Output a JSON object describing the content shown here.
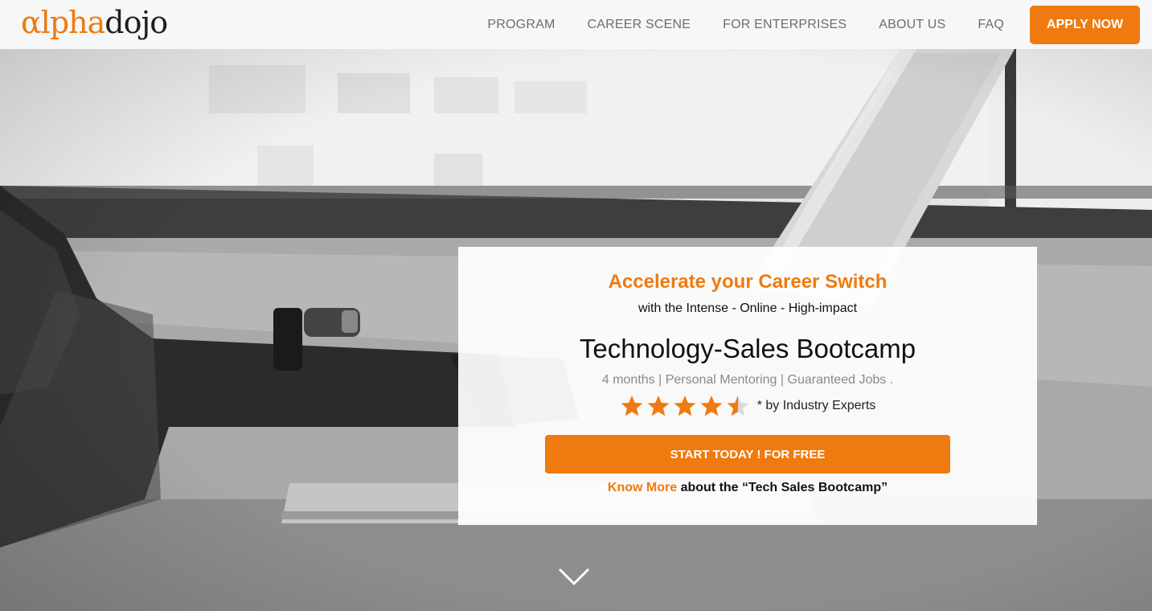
{
  "header": {
    "logo": {
      "alpha_part": "αlpha",
      "dojo_part": "dojo"
    },
    "nav": [
      {
        "label": "PROGRAM"
      },
      {
        "label": "CAREER SCENE"
      },
      {
        "label": "FOR ENTERPRISES"
      },
      {
        "label": "ABOUT US"
      },
      {
        "label": "FAQ"
      }
    ],
    "apply_label": "APPLY NOW"
  },
  "hero_card": {
    "headline": "Accelerate your Career Switch",
    "subheadline": "with the Intense - Online - High-impact",
    "title": "Technology-Sales Bootcamp",
    "features": "4 months | Personal Mentoring | Guaranteed Jobs .",
    "rating": {
      "value": 4.5,
      "max": 5,
      "note": "* by Industry Experts"
    },
    "cta_label": "START TODAY ! FOR FREE",
    "know_more_link": "Know More",
    "know_more_rest": " about the “Tech Sales Bootcamp”"
  },
  "colors": {
    "accent": "#ef7a0f",
    "header_bg": "#f6f7f8",
    "nav_text": "#6d6d6d"
  },
  "icons": {
    "scroll": "chevron-down-icon",
    "rating": "star-icon"
  }
}
